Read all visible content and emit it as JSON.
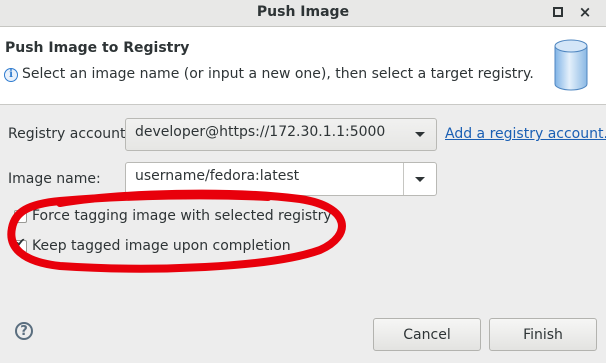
{
  "window": {
    "title": "Push Image",
    "maximize_icon": "maximize-icon",
    "close_icon": "close-icon"
  },
  "header": {
    "title": "Push Image to Registry",
    "message": "Select an image name (or input a new one), then select a target registry.",
    "info_icon": "info-icon",
    "banner_icon": "database-icon"
  },
  "form": {
    "registry_label": "Registry account:",
    "registry_value": "developer@https://172.30.1.1:5000",
    "add_registry_link": "Add a registry account...",
    "image_name_label": "Image name:",
    "image_name_value": "username/fedora:latest"
  },
  "options": {
    "force_tagging_label": "Force tagging image with selected registry",
    "force_tagging_checked": true,
    "keep_tagged_label": "Keep tagged image upon completion",
    "keep_tagged_checked": true
  },
  "footer": {
    "help_icon": "help-icon",
    "cancel_label": "Cancel",
    "finish_label": "Finish"
  },
  "colors": {
    "link": "#1a5fb4",
    "annotation": "#e8000b"
  }
}
